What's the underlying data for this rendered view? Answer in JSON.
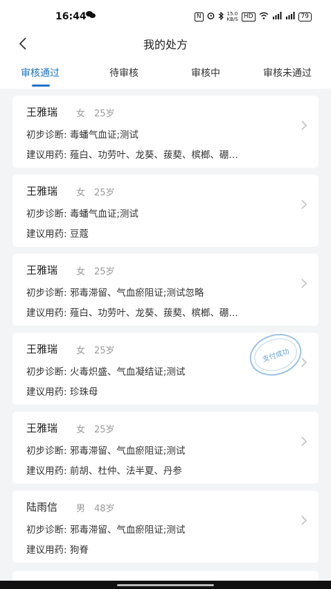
{
  "status_bar": {
    "time": "16:44",
    "network_speed_top": "15.0",
    "network_speed_bottom": "KB/S",
    "hd_badge": "HD",
    "battery": "79"
  },
  "header": {
    "title": "我的处方"
  },
  "tabs": [
    {
      "label": "审核通过",
      "active": true
    },
    {
      "label": "待审核",
      "active": false
    },
    {
      "label": "审核中",
      "active": false
    },
    {
      "label": "审核未通过",
      "active": false
    }
  ],
  "prescriptions": [
    {
      "name": "王雅瑞",
      "gender": "女",
      "age": "25岁",
      "diagnosis_label": "初步诊断:",
      "diagnosis": "毒蟠气血证;测试",
      "medicine_label": "建议用药:",
      "medicine": "薤白、功劳叶、龙葵、菝葜、槟榔、硼…"
    },
    {
      "name": "王雅瑞",
      "gender": "女",
      "age": "25岁",
      "diagnosis_label": "初步诊断:",
      "diagnosis": "毒蟠气血证;测试",
      "medicine_label": "建议用药:",
      "medicine": "豆蔻"
    },
    {
      "name": "王雅瑞",
      "gender": "女",
      "age": "25岁",
      "diagnosis_label": "初步诊断:",
      "diagnosis": "邪毒滞留、气血瘀阻证;测试忽略",
      "medicine_label": "建议用药:",
      "medicine": "薤白、功劳叶、龙葵、菝葜、槟榔、硼…"
    },
    {
      "name": "王雅瑞",
      "gender": "女",
      "age": "25岁",
      "diagnosis_label": "初步诊断:",
      "diagnosis": "火毒炽盛、气血凝结证;测试",
      "medicine_label": "建议用药:",
      "medicine": "珍珠母",
      "stamp": "支付成功"
    },
    {
      "name": "王雅瑞",
      "gender": "女",
      "age": "25岁",
      "diagnosis_label": "初步诊断:",
      "diagnosis": "邪毒滞留、气血瘀阻证;测试",
      "medicine_label": "建议用药:",
      "medicine": "前胡、杜仲、法半夏、丹参"
    },
    {
      "name": "陆雨信",
      "gender": "男",
      "age": "48岁",
      "diagnosis_label": "初步诊断:",
      "diagnosis": "邪毒滞留、气血瘀阻证;测试",
      "medicine_label": "建议用药:",
      "medicine": "狗脊"
    }
  ],
  "colors": {
    "accent": "#1e73c8",
    "background": "#f3f4f6",
    "stamp": "#6aa3d6"
  },
  "icons": {
    "back": "chevron-left-icon",
    "card_arrow": "chevron-right-icon"
  }
}
